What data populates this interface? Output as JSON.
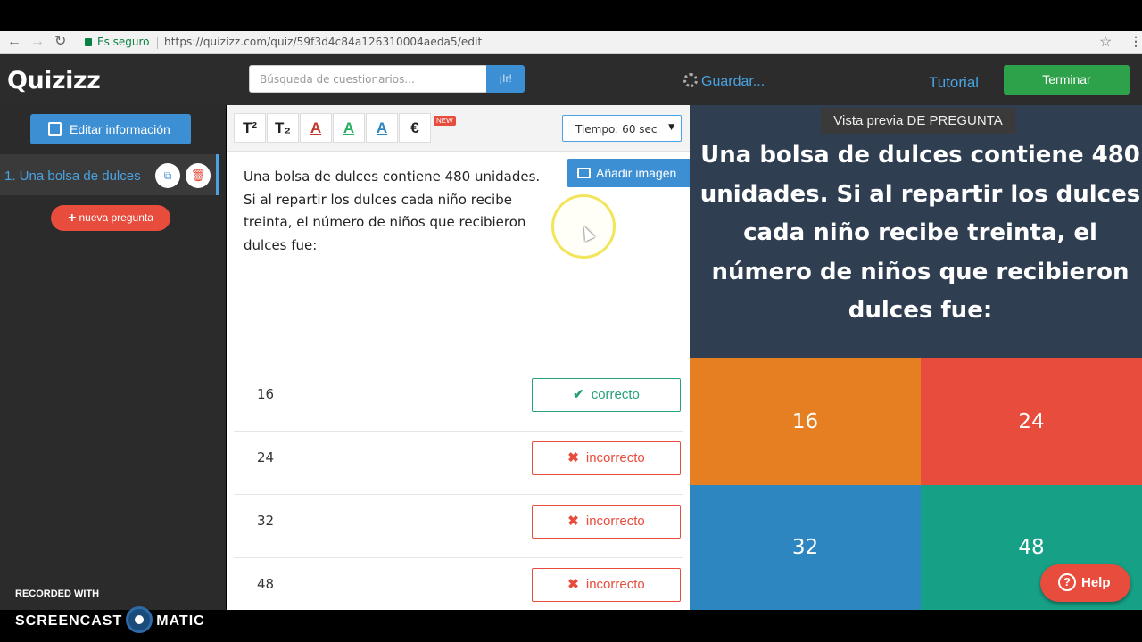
{
  "browser": {
    "back_icon": "←",
    "forward_icon": "→",
    "reload_icon": "↻",
    "secure_label": "Es seguro",
    "url": "https://quizizz.com/quiz/59f3d4c84a126310004aeda5/edit",
    "star_icon": "☆",
    "menu_icon": "⋮"
  },
  "header": {
    "logo": "Quizizz",
    "search_placeholder": "Búsqueda de cuestionarios...",
    "go_label": "¡Ir!",
    "saving_label": "Guardar...",
    "tutorial_label": "Tutorial",
    "finish_label": "Terminar"
  },
  "sidebar": {
    "edit_info_label": "Editar información",
    "question_item": "1.  Una bolsa de dulces",
    "copy_icon": "⧉",
    "delete_icon": "🗑",
    "new_question_plus": "+",
    "new_question_label": "nueva pregunta"
  },
  "watermark": {
    "line1": "RECORDED WITH",
    "left": "SCREENCAST",
    "right": "MATIC"
  },
  "editor": {
    "toolbar": {
      "superscript": "T²",
      "subscript": "T₂",
      "color_red": "A",
      "color_green": "A",
      "color_blue": "A",
      "euro": "€",
      "new_badge": "NEW"
    },
    "timer_label": "Tiempo: 60 sec",
    "timer_arrow": "▼",
    "add_image_label": "Añadir imagen",
    "question_text": "Una bolsa de dulces contiene 480 unidades. Si al repartir los dulces cada niño recibe treinta, el número de niños que recibieron dulces fue:",
    "answers": [
      {
        "value": "16",
        "mark": "✔",
        "status": "correcto"
      },
      {
        "value": "24",
        "mark": "✖",
        "status": "incorrecto"
      },
      {
        "value": "32",
        "mark": "✖",
        "status": "incorrecto"
      },
      {
        "value": "48",
        "mark": "✖",
        "status": "incorrecto"
      }
    ]
  },
  "preview": {
    "label": "Vista previa DE PREGUNTA",
    "question_text": "Una bolsa de dulces contiene 480 unidades. Si al repartir los dulces cada niño recibe treinta, el número de niños que recibieron dulces fue:",
    "options": [
      "16",
      "24",
      "32",
      "48"
    ],
    "colors": [
      "#e67e22",
      "#e74c3c",
      "#2e86c1",
      "#16a085"
    ],
    "help_icon": "?",
    "help_label": "Help"
  }
}
